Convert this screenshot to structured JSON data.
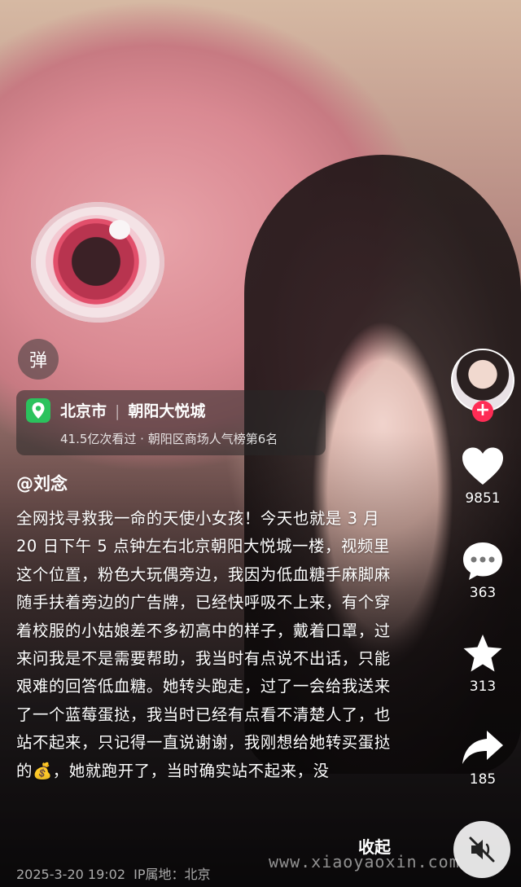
{
  "danmu_label": "弹",
  "location": {
    "city": "北京市",
    "place": "朝阳大悦城",
    "stats": "41.5亿次看过 · 朝阳区商场人气榜第6名"
  },
  "author": "@刘念",
  "caption": "全网找寻救我一命的天使小女孩！今天也就是 3 月 20 日下午 5 点钟左右北京朝阳大悦城一楼，视频里这个位置，粉色大玩偶旁边，我因为低血糖手麻脚麻随手扶着旁边的广告牌，已经快呼吸不上来，有个穿着校服的小姑娘差不多初高中的样子，戴着口罩，过来问我是不是需要帮助，我当时有点说不出话，只能艰难的回答低血糖。她转头跑走，过了一会给我送来了一个蓝莓蛋挞，我当时已经有点看不清楚人了，也站不起来，只记得一直说谢谢，我刚想给她转买蛋挞的💰，她就跑开了，当时确实站不起来，没",
  "collapse_label": "收起",
  "meta": {
    "date": "2025-3-20 19:02",
    "ip": "IP属地：北京"
  },
  "watermark": "www.xiaoyaoxin.com",
  "actions": {
    "follow_symbol": "+",
    "likes": "9851",
    "comments": "363",
    "favorites": "313",
    "shares": "185"
  },
  "colors": {
    "like": "#ffffff",
    "follow_badge": "#fe2c55",
    "location_pin": "#2bc25d"
  },
  "icons": [
    "danmu-icon",
    "location-pin-icon",
    "heart-icon",
    "comment-icon",
    "star-icon",
    "share-icon",
    "mute-icon"
  ]
}
